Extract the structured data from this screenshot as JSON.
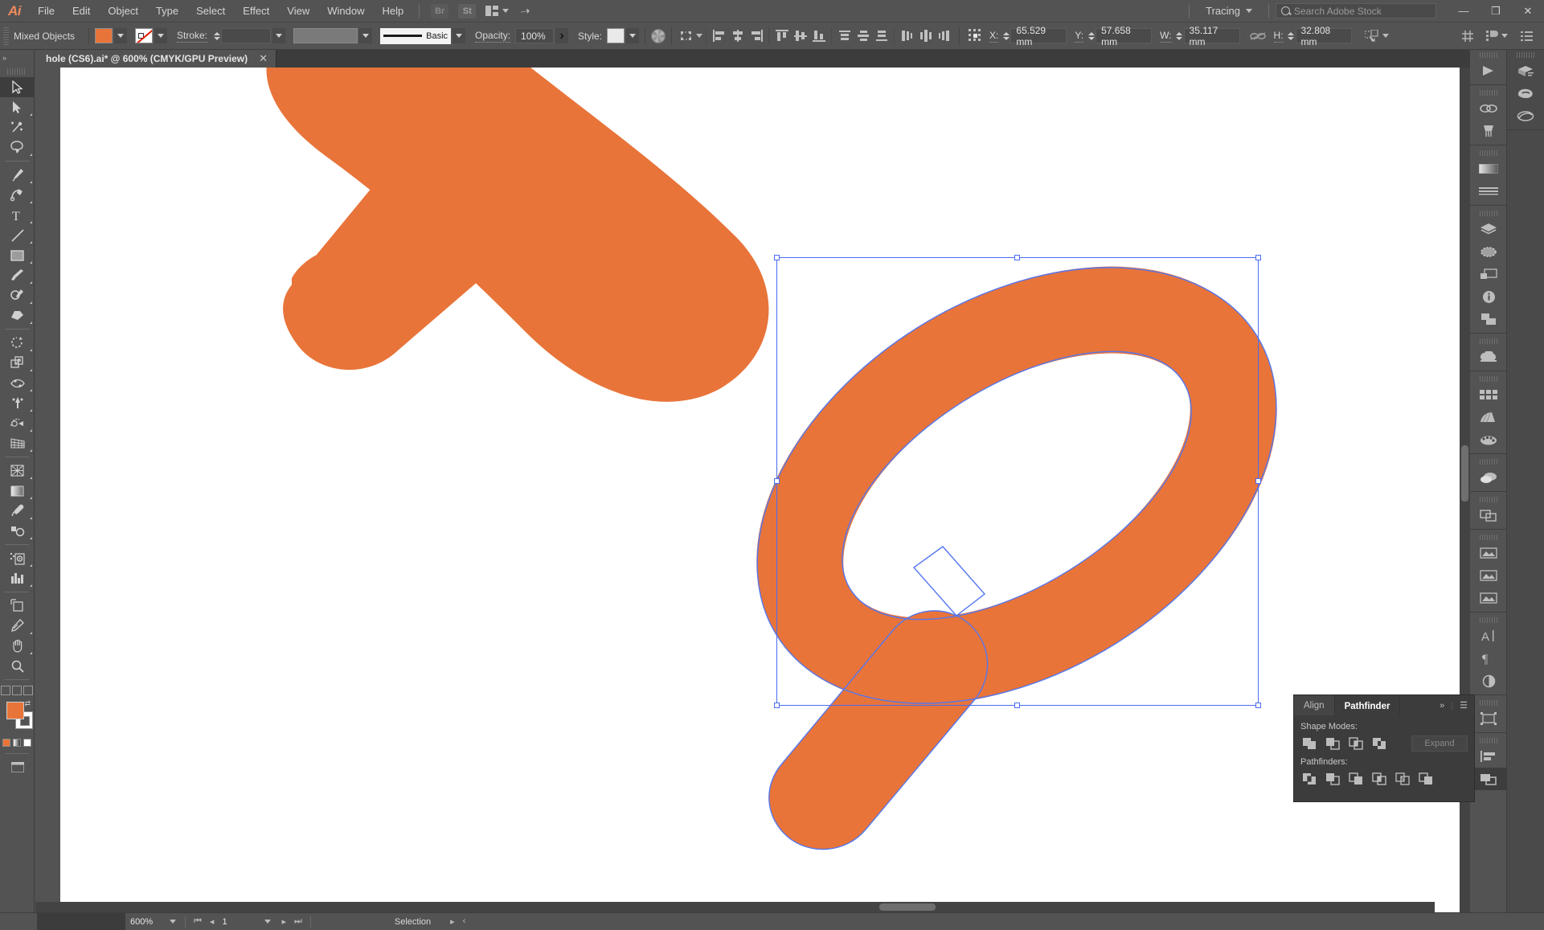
{
  "app": {
    "name": "Adobe Illustrator",
    "logo": "Ai"
  },
  "menubar": {
    "items": [
      "File",
      "Edit",
      "Object",
      "Type",
      "Select",
      "Effect",
      "View",
      "Window",
      "Help"
    ],
    "bridge_label": "Br",
    "stock_label": "St",
    "arrange_icon": "arrange-documents-icon",
    "rocket_icon": "rocket-icon",
    "workspace": "Tracing",
    "search_placeholder": "Search Adobe Stock",
    "window_buttons": {
      "minimize": "—",
      "restore": "❐",
      "close": "✕"
    }
  },
  "controlbar": {
    "object_label": "Mixed Objects",
    "fill_color": "#e8743a",
    "stroke_label": "Stroke:",
    "stroke_weight": "",
    "stroke_profile": "",
    "brush_label": "Basic",
    "opacity_label": "Opacity:",
    "opacity_value": "100%",
    "style_label": "Style:",
    "x_label": "X:",
    "x_value": "65.529 mm",
    "y_label": "Y:",
    "y_value": "57.658 mm",
    "w_label": "W:",
    "w_value": "35.117 mm",
    "h_label": "H:",
    "h_value": "32.808 mm",
    "lock_icon": "constrain-proportions-unlinked-icon",
    "transform_icon": "transform-icon",
    "align_icons": [
      "align-left-icon",
      "align-center-horizontal-icon",
      "align-right-icon",
      "align-top-icon",
      "align-center-vertical-icon",
      "align-bottom-icon",
      "distribute-left-icon",
      "distribute-center-h-icon",
      "distribute-right-icon",
      "distribute-vertical-icons"
    ],
    "reference_point_icon": "reference-point-grid-icon",
    "snap_icon": "align-to-pixel-grid-icon",
    "document_setup_icon": "document-setup-icon",
    "preferences_icon": "preferences-icon"
  },
  "document_tab": {
    "title": "hole (CS6).ai* @ 600% (CMYK/GPU Preview)",
    "close": "✕"
  },
  "toolbar": {
    "tools": [
      {
        "name": "selection-tool",
        "selected": true
      },
      {
        "name": "direct-selection-tool",
        "selected": false
      },
      {
        "name": "magic-wand-tool",
        "selected": false
      },
      {
        "name": "lasso-tool",
        "selected": false
      },
      {
        "name": "pen-tool",
        "selected": false
      },
      {
        "name": "curvature-tool",
        "selected": false
      },
      {
        "name": "type-tool",
        "selected": false
      },
      {
        "name": "line-segment-tool",
        "selected": false
      },
      {
        "name": "rectangle-tool",
        "selected": false
      },
      {
        "name": "paintbrush-tool",
        "selected": false
      },
      {
        "name": "shaper-pencil-tool",
        "selected": false
      },
      {
        "name": "eraser-tool",
        "selected": false
      },
      {
        "name": "rotate-tool",
        "selected": false
      },
      {
        "name": "scale-tool",
        "selected": false
      },
      {
        "name": "width-tool",
        "selected": false
      },
      {
        "name": "free-transform-tool",
        "selected": false
      },
      {
        "name": "shape-builder-tool",
        "selected": false
      },
      {
        "name": "perspective-grid-tool",
        "selected": false
      },
      {
        "name": "mesh-tool",
        "selected": false
      },
      {
        "name": "gradient-tool",
        "selected": false
      },
      {
        "name": "eyedropper-tool",
        "selected": false
      },
      {
        "name": "blend-tool",
        "selected": false
      },
      {
        "name": "symbol-sprayer-tool",
        "selected": false
      },
      {
        "name": "column-graph-tool",
        "selected": false
      },
      {
        "name": "artboard-tool",
        "selected": false
      },
      {
        "name": "slice-tool",
        "selected": false
      },
      {
        "name": "hand-tool",
        "selected": false
      },
      {
        "name": "zoom-tool",
        "selected": false
      }
    ],
    "fill_color": "#e8743a",
    "stroke_color": "#ffffff"
  },
  "canvas": {
    "artwork_color": "#e8743a",
    "selection_color": "#4a6cf0",
    "zoom": "600%"
  },
  "right_dock": {
    "groups": [
      [
        "export-for-screens-icon"
      ],
      [
        "links-icon",
        "brushes-icon"
      ],
      [
        "gradient-icon",
        "stroke-panel-icon"
      ],
      [
        "layers-icon",
        "appearance-icon",
        "artboards-icon",
        "document-info-icon",
        "graphic-styles-icon"
      ],
      [
        "libraries-icon"
      ],
      [
        "swatches-icon",
        "gradient-panel-icon",
        "color-panel-icon"
      ],
      [
        "transparency-icon"
      ],
      [
        "pathfinder-panel-icon"
      ],
      [
        "image-trace-icon",
        "image-trace-2-icon",
        "image-trace-3-icon"
      ],
      [
        "character-icon",
        "paragraph-icon",
        "opacity-mask-icon"
      ],
      [
        "artboards-panel-icon"
      ],
      [
        "align-panel-icon"
      ],
      [
        "pathfinder-active-icon"
      ]
    ],
    "column_b": [
      "3d-icon",
      "blob-icon",
      "symbols-icon"
    ]
  },
  "pathfinder": {
    "tabs": [
      {
        "label": "Align",
        "active": false
      },
      {
        "label": "Pathfinder",
        "active": true
      }
    ],
    "overflow": "»",
    "menu_icon": "panel-menu-icon",
    "shape_modes_label": "Shape Modes:",
    "shape_modes": [
      "unite-icon",
      "minus-front-icon",
      "intersect-icon",
      "exclude-icon"
    ],
    "expand_label": "Expand",
    "pathfinders_label": "Pathfinders:",
    "pathfinders": [
      "divide-icon",
      "trim-icon",
      "merge-icon",
      "crop-icon",
      "outline-icon",
      "minus-back-icon"
    ]
  },
  "statusbar": {
    "zoom": "600%",
    "page": "1",
    "status": "Selection",
    "first_icon": "first-page-icon",
    "prev_icon": "prev-page-icon",
    "next_icon": "next-page-icon",
    "last_icon": "last-page-icon"
  }
}
